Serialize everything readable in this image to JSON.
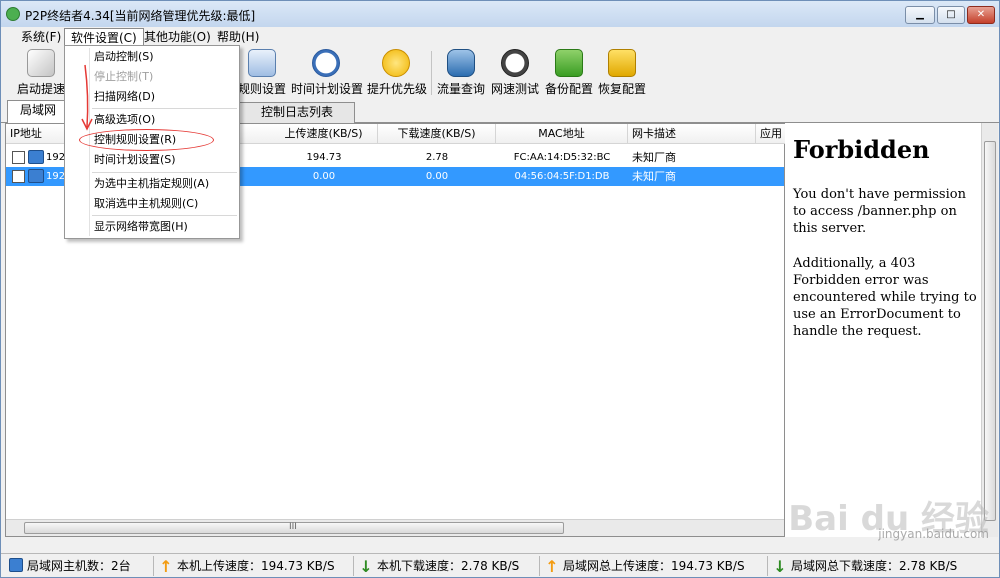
{
  "window": {
    "title": "P2P终结者4.34[当前网络管理优先级:最低]",
    "controls": {
      "minimize": "▁",
      "maximize": "□",
      "close": "✕"
    }
  },
  "menubar": [
    "系统(F)",
    "软件设置(C)",
    "其他功能(O)",
    "帮助(H)"
  ],
  "toolbar": [
    {
      "label": "启动提速",
      "icon": "rocket-icon"
    },
    {
      "label": "规则设置",
      "icon": "rules-icon"
    },
    {
      "label": "时间计划设置",
      "icon": "clock-icon"
    },
    {
      "label": "提升优先级",
      "icon": "medal-icon"
    },
    {
      "label": "流量查询",
      "icon": "database-globe-icon"
    },
    {
      "label": "网速测试",
      "icon": "speedometer-icon"
    },
    {
      "label": "备份配置",
      "icon": "backup-icon"
    },
    {
      "label": "恢复配置",
      "icon": "restore-icon"
    }
  ],
  "tabs": [
    "局域网",
    "控制日志列表"
  ],
  "table": {
    "columns": [
      "IP地址",
      "上传速度(KB/S)",
      "下载速度(KB/S)",
      "MAC地址",
      "网卡描述",
      "应用"
    ],
    "rows": [
      {
        "ip": "192",
        "up": "194.73",
        "down": "2.78",
        "mac": "FC:AA:14:D5:32:BC",
        "vendor": "未知厂商",
        "selected": false
      },
      {
        "ip": "192",
        "up": "0.00",
        "down": "0.00",
        "mac": "04:56:04:5F:D1:DB",
        "vendor": "未知厂商",
        "selected": true
      }
    ]
  },
  "dropdown": {
    "items": [
      "启动控制(S)",
      "停止控制(T)",
      "扫描网络(D)",
      "高级选项(O)",
      "控制规则设置(R)",
      "时间计划设置(S)",
      "为选中主机指定规则(A)",
      "取消选中主机规则(C)",
      "显示网络带宽图(H)"
    ]
  },
  "forbidden": {
    "title": "Forbidden",
    "p1": "You don't have permission to access /banner.php on this server.",
    "p2": "Additionally, a 403 Forbidden error was encountered while trying to use an ErrorDocument to handle the request."
  },
  "statusbar": {
    "hosts": "局域网主机数：2台",
    "local_up": "本机上传速度：194.73 KB/S",
    "local_down": "本机下载速度：2.78 KB/S",
    "lan_up": "局域网总上传速度：194.73 KB/S",
    "lan_down": "局域网总下载速度：2.78 KB/S"
  },
  "scrollbar_grip": "III",
  "watermark": {
    "brand": "Bai du 经验",
    "url": "jingyan.baidu.com"
  },
  "colors": {
    "selection": "#3399ff",
    "highlight_ring": "#e53935",
    "up_arrow": "#f39c12",
    "down_arrow": "#2e8b22"
  }
}
